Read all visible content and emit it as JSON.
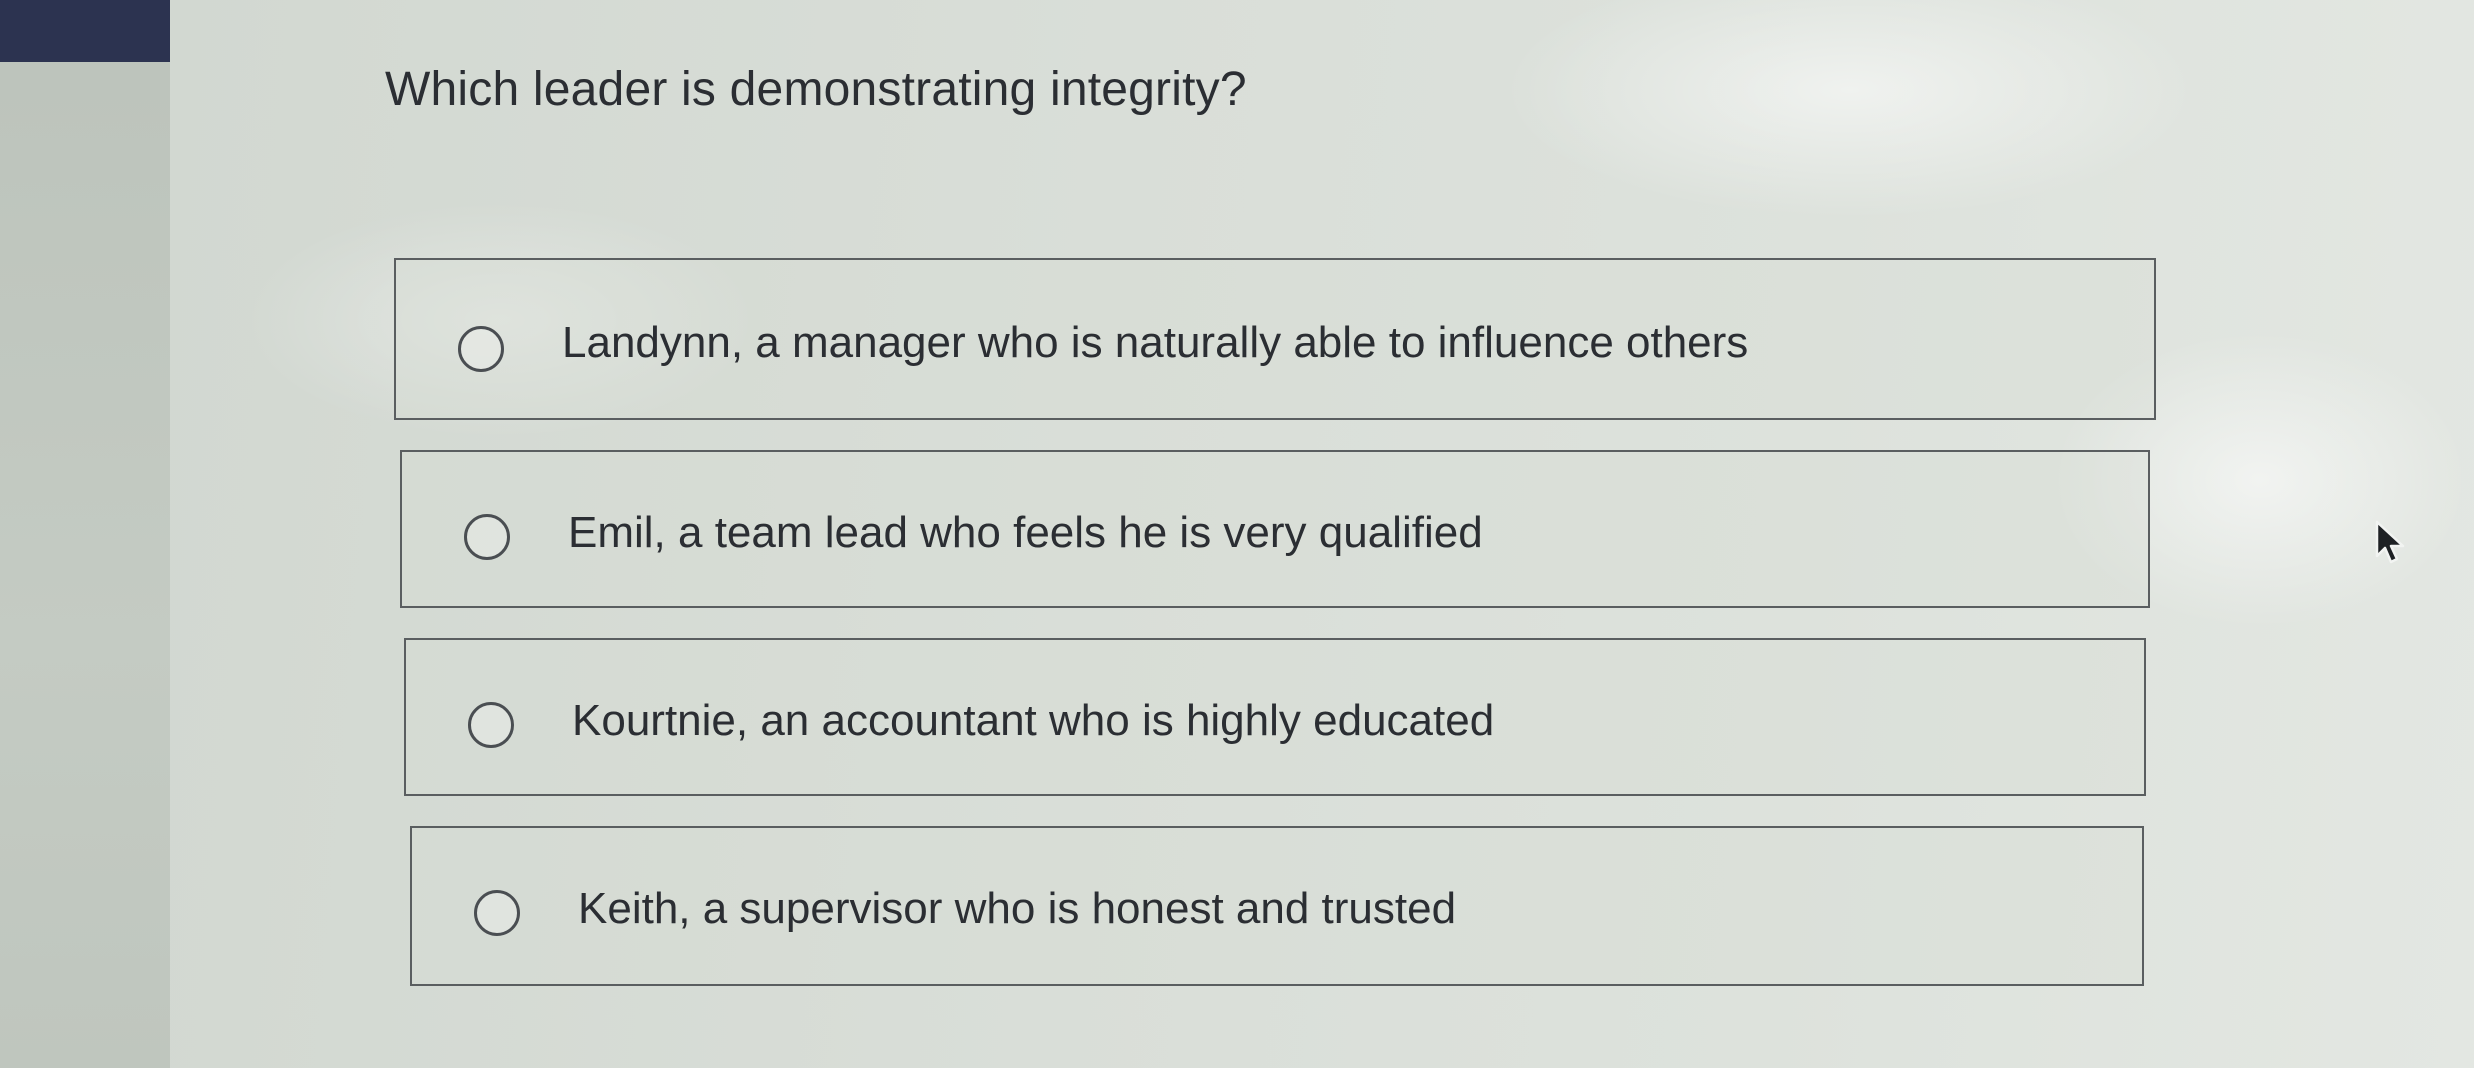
{
  "question": {
    "text": "Which leader is demonstrating integrity?"
  },
  "options": [
    {
      "label": "Landynn, a manager who is naturally able to influence others",
      "selected": false
    },
    {
      "label": "Emil, a team lead who feels he is very qualified",
      "selected": false
    },
    {
      "label": "Kourtnie, an accountant who is highly educated",
      "selected": false
    },
    {
      "label": "Keith, a supervisor who is honest and trusted",
      "selected": false
    }
  ],
  "colors": {
    "header_bar": "#2c3350",
    "text": "#2b2e33",
    "border": "#5a5e60"
  },
  "icons": {
    "radio": "radio-unchecked-icon",
    "cursor": "mouse-pointer-icon"
  }
}
